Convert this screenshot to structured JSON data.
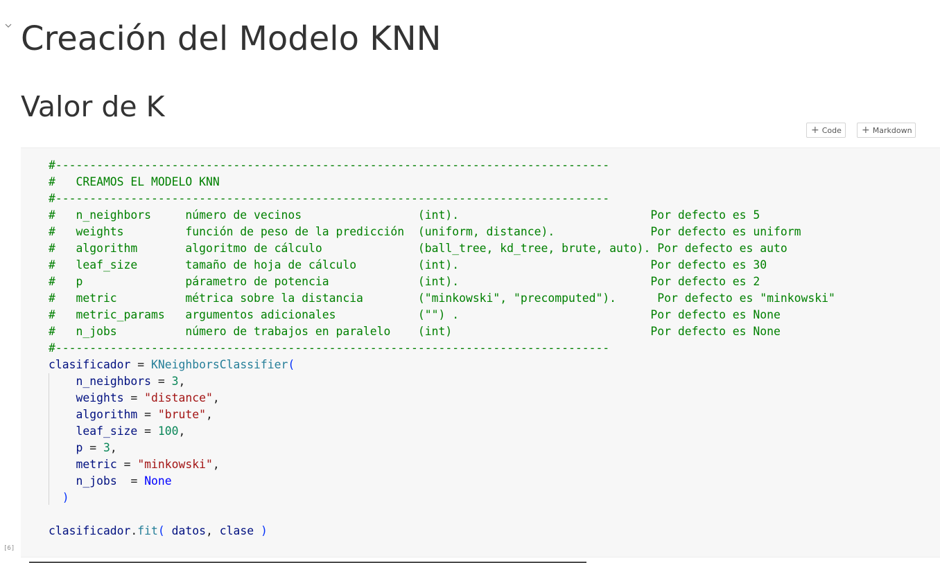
{
  "notebook": {
    "heading_1": "Creación del Modelo KNN",
    "heading_2": "Valor de K",
    "toolbar": {
      "add_code_label": "Code",
      "add_markdown_label": "Markdown"
    },
    "cell": {
      "execution_count": "[6]",
      "code_lines": [
        "#---------------------------------------------------------------------------------",
        "#   CREAMOS EL MODELO KNN",
        "#---------------------------------------------------------------------------------",
        "#   n_neighbors     número de vecinos                 (int).                            Por defecto es 5",
        "#   weights         función de peso de la predicción  (uniform, distance).              Por defecto es uniform",
        "#   algorithm       algoritmo de cálculo              (ball_tree, kd_tree, brute, auto). Por defecto es auto",
        "#   leaf_size       tamaño de hoja de cálculo         (int).                            Por defecto es 30",
        "#   p               párametro de potencia             (int).                            Por defecto es 2",
        "#   metric          métrica sobre la distancia        (\"minkowski\", \"precomputed\").      Por defecto es \"minkowski\"",
        "#   metric_params   argumentos adicionales            (\"\") .                            Por defecto es None",
        "#   n_jobs          número de trabajos en paralelo    (int)                             Por defecto es None",
        "#---------------------------------------------------------------------------------",
        "clasificador = KNeighborsClassifier(",
        "    n_neighbors = 3,",
        "    weights = \"distance\",",
        "    algorithm = \"brute\",",
        "    leaf_size = 100,",
        "    p = 3,",
        "    metric = \"minkowski\",",
        "    n_jobs  = None",
        "  )",
        "",
        "clasificador.fit( datos, clase )"
      ]
    }
  }
}
